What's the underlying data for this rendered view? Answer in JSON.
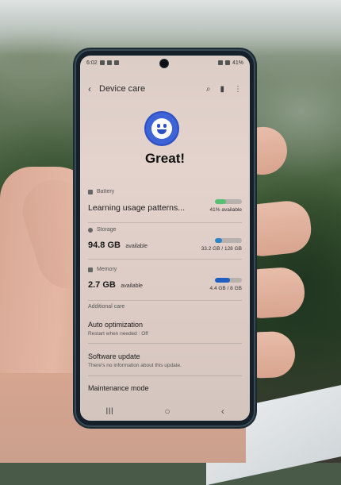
{
  "status_bar": {
    "time": "6:02",
    "battery": "41%"
  },
  "app_bar": {
    "title": "Device care",
    "icons": [
      "back-arrow-icon",
      "search-icon",
      "signal-bars-icon",
      "more-vert-icon"
    ]
  },
  "status_summary": {
    "emoji": "smiley-face-icon",
    "headline": "Great!"
  },
  "battery": {
    "label": "Battery",
    "status": "Learning usage patterns...",
    "available": "41% available",
    "fill_fraction": 0.41,
    "color": "#56c271"
  },
  "storage": {
    "label": "Storage",
    "amount": "94.8 GB",
    "suffix": "available",
    "usage": "33.2 GB / 128 GB",
    "fill_fraction": 0.26,
    "color": "#2a86c9"
  },
  "memory": {
    "label": "Memory",
    "amount": "2.7 GB",
    "suffix": "available",
    "usage": "4.4 GB / 8 GB",
    "fill_fraction": 0.55,
    "color": "#1f5fc2"
  },
  "additional_care": {
    "section_label": "Additional care",
    "items": [
      {
        "title": "Auto optimization",
        "subtitle": "Restart when needed : Off"
      },
      {
        "title": "Software update",
        "subtitle": "There's no information about this update."
      },
      {
        "title": "Maintenance mode",
        "subtitle": ""
      }
    ]
  },
  "navigation": {
    "recents": "III",
    "home": "○",
    "back": "‹"
  }
}
